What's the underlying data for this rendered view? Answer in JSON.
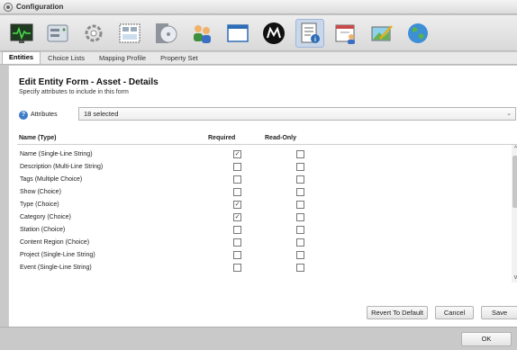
{
  "window": {
    "title": "Configuration"
  },
  "toolbar": {
    "icons": [
      {
        "name": "monitor-icon",
        "active": false
      },
      {
        "name": "server-icon",
        "active": false
      },
      {
        "name": "gear-icon",
        "active": false
      },
      {
        "name": "layout-icon",
        "active": false
      },
      {
        "name": "media-disc-icon",
        "active": false
      },
      {
        "name": "users-icon",
        "active": false
      },
      {
        "name": "window-icon",
        "active": false
      },
      {
        "name": "logo-m-icon",
        "active": false
      },
      {
        "name": "form-info-icon",
        "active": true
      },
      {
        "name": "calendar-user-icon",
        "active": false
      },
      {
        "name": "picture-edit-icon",
        "active": false
      },
      {
        "name": "globe-icon",
        "active": false
      }
    ]
  },
  "tabs": [
    {
      "label": "Entities",
      "active": true
    },
    {
      "label": "Choice Lists",
      "active": false
    },
    {
      "label": "Mapping Profile",
      "active": false
    },
    {
      "label": "Property Set",
      "active": false
    }
  ],
  "form": {
    "title": "Edit Entity Form - Asset - Details",
    "subtitle": "Specify attributes to include in this form",
    "attributes_label": "Attributes",
    "attributes_value": "18 selected"
  },
  "table": {
    "columns": {
      "name": "Name (Type)",
      "required": "Required",
      "readonly": "Read-Only"
    },
    "rows": [
      {
        "name": "Name (Single-Line String)",
        "required": true,
        "readonly": false
      },
      {
        "name": "Description (Multi-Line String)",
        "required": false,
        "readonly": false
      },
      {
        "name": "Tags (Multiple Choice)",
        "required": false,
        "readonly": false
      },
      {
        "name": "Show (Choice)",
        "required": false,
        "readonly": false
      },
      {
        "name": "Type (Choice)",
        "required": true,
        "readonly": false
      },
      {
        "name": "Category (Choice)",
        "required": true,
        "readonly": false
      },
      {
        "name": "Station (Choice)",
        "required": false,
        "readonly": false
      },
      {
        "name": "Content Region (Choice)",
        "required": false,
        "readonly": false
      },
      {
        "name": "Project (Single-Line String)",
        "required": false,
        "readonly": false
      },
      {
        "name": "Event (Single-Line String)",
        "required": false,
        "readonly": false
      }
    ]
  },
  "buttons": {
    "revert": "Revert To Default",
    "cancel": "Cancel",
    "save": "Save",
    "ok": "OK"
  }
}
